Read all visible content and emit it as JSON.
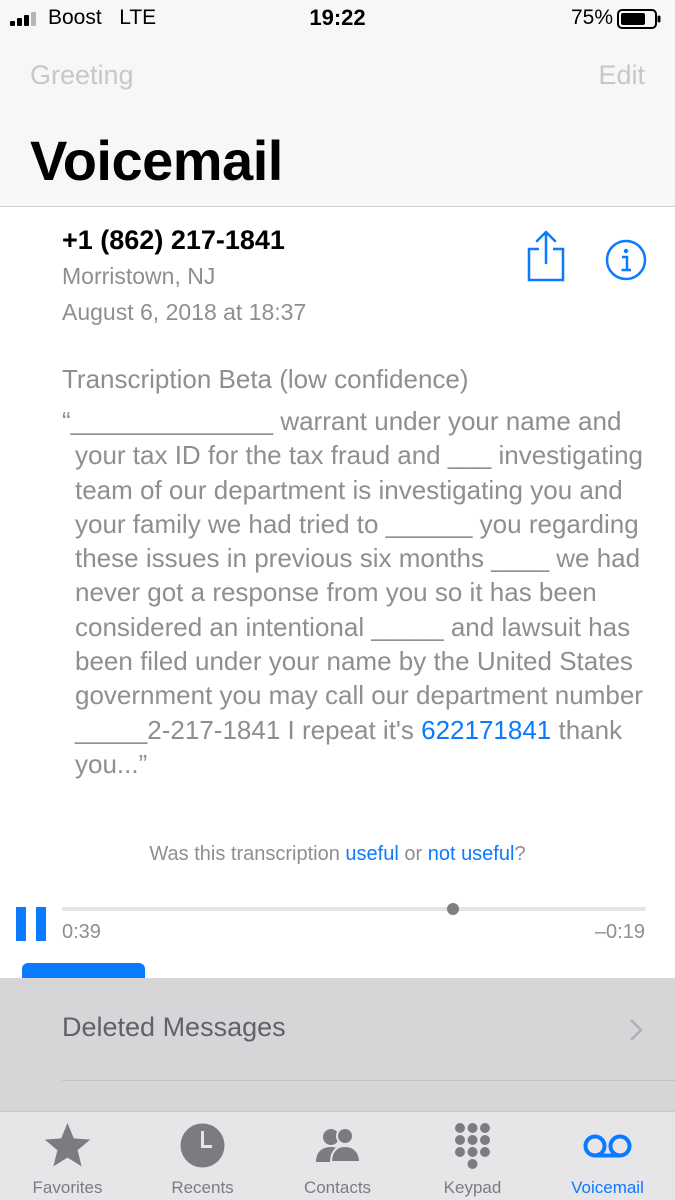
{
  "status_bar": {
    "carrier": "Boost",
    "network": "LTE",
    "time": "19:22",
    "battery": "75%",
    "battery_level": 0.75
  },
  "nav": {
    "left_button": "Greeting",
    "right_button": "Edit",
    "title": "Voicemail"
  },
  "voicemail": {
    "number": "+1 (862) 217-1841",
    "location": "Morristown, NJ",
    "date": "August 6, 2018 at 18:37",
    "transcription_title": "Transcription Beta (low confidence)",
    "transcript_part1": "“______________ warrant under your name and your tax ID for the tax fraud and ___ investigating team of our department is investigating you and your family we had tried to ______ you regarding these issues in previous six months ____ we had never got a response from you so it has been considered an intentional _____ and lawsuit has been filed under your name by the United States government you may call our department number _____2-217-1841 I repeat it's ",
    "transcript_number": "622171841",
    "transcript_part2": " thank you...”",
    "feedback_prefix": "Was this transcription ",
    "feedback_useful": "useful",
    "feedback_or": " or ",
    "feedback_not_useful": "not useful",
    "feedback_suffix": "?",
    "elapsed": "0:39",
    "remaining": "–0:19",
    "progress": 0.67
  },
  "list": {
    "deleted_messages": "Deleted Messages"
  },
  "tabs": [
    {
      "label": "Favorites",
      "icon": "star-icon"
    },
    {
      "label": "Recents",
      "icon": "clock-icon"
    },
    {
      "label": "Contacts",
      "icon": "contacts-icon"
    },
    {
      "label": "Keypad",
      "icon": "keypad-icon"
    },
    {
      "label": "Voicemail",
      "icon": "voicemail-icon",
      "active": true
    }
  ],
  "colors": {
    "accent": "#0a7aff",
    "secondary_text": "#8e8e93",
    "destructive": "#ff3b30"
  }
}
